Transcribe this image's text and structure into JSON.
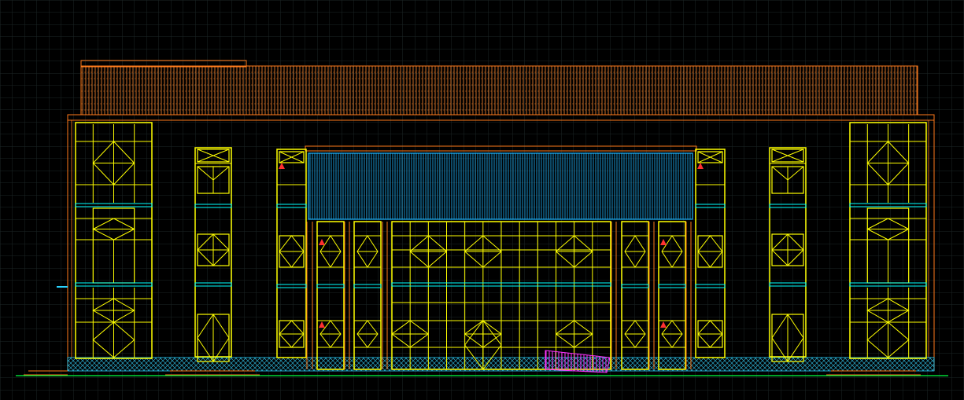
{
  "drawing": {
    "view": "front elevation",
    "background_color": "#000000",
    "grid_color": "#1f2a2a",
    "colors": {
      "roof_band": "#ff8a30",
      "outline": "#ff7a1a",
      "window_frame": "#ffff00",
      "canopy": "#1fb6ff",
      "base_hatch": "#2ad4ff",
      "ramp": "#ff33ff",
      "marker": "#ff3030",
      "ground": "#00ff40",
      "sill": "#00ffff"
    }
  }
}
